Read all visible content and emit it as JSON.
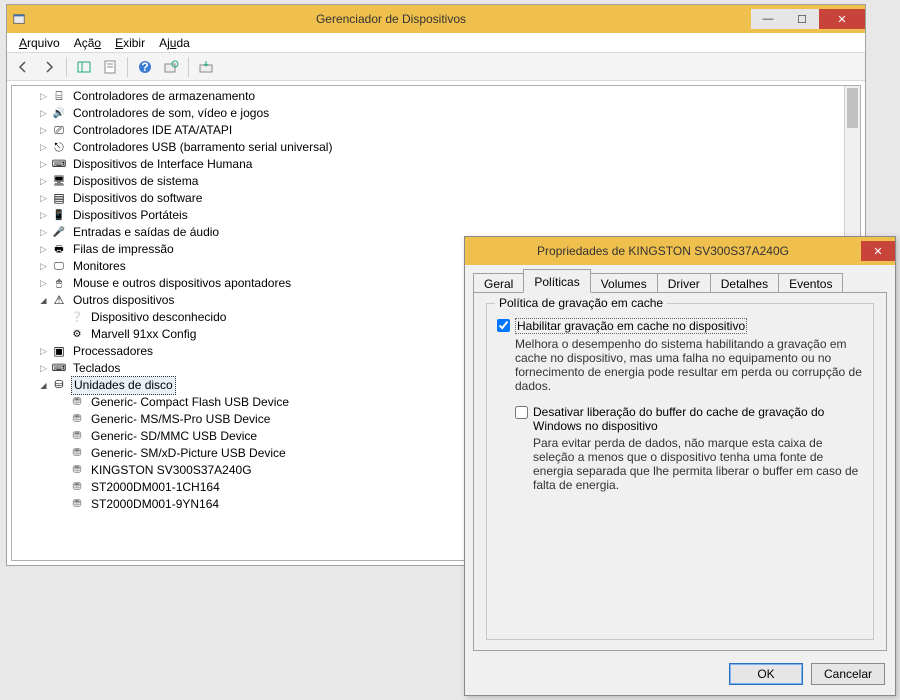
{
  "main": {
    "title": "Gerenciador de Dispositivos",
    "menu": {
      "file": "Arquivo",
      "action": "Ação",
      "view": "Exibir",
      "help": "Ajuda"
    }
  },
  "tree": {
    "storage": "Controladores de armazenamento",
    "sound": "Controladores de som, vídeo e jogos",
    "ide": "Controladores IDE ATA/ATAPI",
    "usb": "Controladores USB (barramento serial universal)",
    "hid": "Dispositivos de Interface Humana",
    "system": "Dispositivos de sistema",
    "software": "Dispositivos do software",
    "portable": "Dispositivos Portáteis",
    "audio": "Entradas e saídas de áudio",
    "printq": "Filas de impressão",
    "monitors": "Monitores",
    "mouse": "Mouse e outros dispositivos apontadores",
    "other": "Outros dispositivos",
    "other_unknown": "Dispositivo desconhecido",
    "other_marvell": "Marvell 91xx Config",
    "cpus": "Processadores",
    "keyboards": "Teclados",
    "disks": "Unidades de disco",
    "disk_items": [
      "Generic- Compact Flash USB Device",
      "Generic- MS/MS-Pro USB Device",
      "Generic- SD/MMC USB Device",
      "Generic- SM/xD-Picture USB Device",
      "KINGSTON SV300S37A240G",
      "ST2000DM001-1CH164",
      "ST2000DM001-9YN164"
    ]
  },
  "props": {
    "title": "Propriedades de KINGSTON SV300S37A240G",
    "tabs": {
      "general": "Geral",
      "policies": "Políticas",
      "volumes": "Volumes",
      "driver": "Driver",
      "details": "Detalhes",
      "events": "Eventos"
    },
    "group_legend": "Política de gravação em cache",
    "chk1_label": "Habilitar gravação em cache no dispositivo",
    "chk1_desc": "Melhora o desempenho do sistema habilitando a gravação em cache no dispositivo, mas uma falha no equipamento ou no fornecimento de energia pode resultar em perda ou corrupção de dados.",
    "chk2_label": "Desativar liberação do buffer do cache de gravação do Windows no dispositivo",
    "chk2_desc": "Para evitar perda de dados, não marque esta caixa de seleção a menos que o dispositivo tenha uma fonte de energia separada que lhe permita liberar o buffer em caso de falta de energia.",
    "ok": "OK",
    "cancel": "Cancelar"
  }
}
